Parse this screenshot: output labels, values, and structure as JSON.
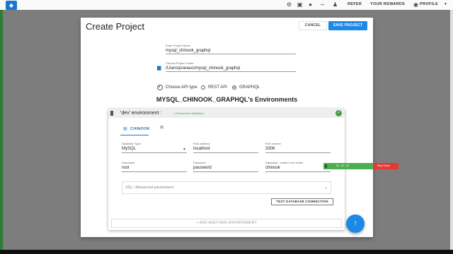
{
  "topbar": {
    "links": [
      "REFER",
      "YOUR REWARDS",
      "PROFILE"
    ],
    "icons": [
      "gear-icon",
      "discord-icon",
      "github-icon",
      "twitter-icon",
      "notification-icon"
    ]
  },
  "dialog": {
    "title": "Create Project",
    "cancel_label": "CANCEL",
    "save_label": "SAVE PROJECT",
    "project_name_label": "Enter Project Name",
    "project_name_value": "mysql_chinook_graphql",
    "folder_label": "Choose Project Folder",
    "folder_value": "/Users/pranavc/mysql_chinook_graphql",
    "api_type_label": "Choose API type",
    "api_options": [
      "REST API",
      "GRAPHQL"
    ],
    "api_selected": "GRAPHQL",
    "environments_heading": "MYSQL_CHINOOK_GRAPHQL's Environments"
  },
  "environment": {
    "title": "'dev' environment :",
    "validated_text": "( Environment Validated )",
    "db_tab_label": "CHINOOK",
    "fields": {
      "db_type_label": "Database Type",
      "db_type_value": "MySQL",
      "host_label": "Host address",
      "host_value": "localhost",
      "port_label": "Port number",
      "port_value": "3306",
      "username_label": "Username",
      "username_value": "root",
      "password_label": "Password",
      "password_value": "password",
      "database_label": "Database : create if not exists",
      "database_value": "chinook"
    },
    "ssl_label": "SSL / Advanced parameters",
    "test_button_label": "TEST DATABASE CONNECTION",
    "add_env_label": "+ ADD ANOTHER ENVIRONMENT"
  },
  "share_indicator": {
    "timer": "00 : 00 : 00",
    "stop_label": "Stop Share"
  },
  "colors": {
    "primary": "#1e88e5",
    "valid_green": "#43a047",
    "stop_red": "#e53935"
  }
}
